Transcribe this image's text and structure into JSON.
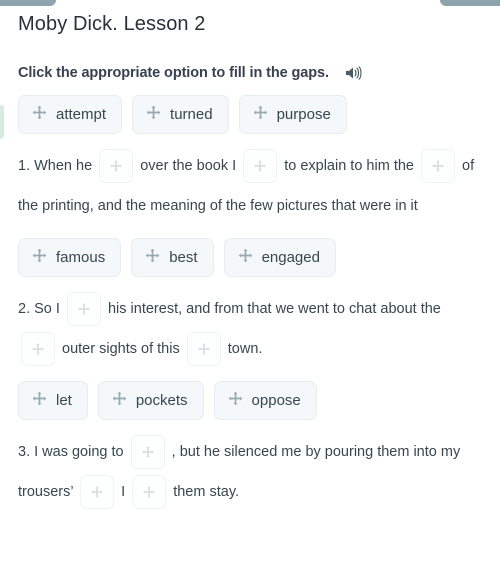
{
  "window": {
    "chrome_bar_color": "#8ea4ac",
    "left_accent_color": "#d9ecdf"
  },
  "header": {
    "lesson_title": "Moby Dick. Lesson 2"
  },
  "instruction": {
    "text": "Click the appropriate option to fill in the gaps.",
    "audio_icon": "speaker-icon"
  },
  "colors": {
    "chip_background": "#f4f8fa",
    "chip_border": "#e6edf1",
    "text": "#37474f",
    "icon": "#96a8b4",
    "gap_icon": "#d7dee3"
  },
  "exercise": {
    "blocks": [
      {
        "word_bank": [
          {
            "label": "attempt",
            "icon": "move-icon"
          },
          {
            "label": "turned",
            "icon": "move-icon"
          },
          {
            "label": "purpose",
            "icon": "move-icon"
          }
        ],
        "sentence_number": "1.",
        "segments": [
          {
            "type": "text",
            "value": "1. When he "
          },
          {
            "type": "gap"
          },
          {
            "type": "text",
            "value": " over the book I "
          },
          {
            "type": "gap"
          },
          {
            "type": "text",
            "value": " to explain to him the "
          },
          {
            "type": "gap"
          },
          {
            "type": "text",
            "value": " of the printing, and the meaning of the few pictures that were in it"
          }
        ]
      },
      {
        "word_bank": [
          {
            "label": "famous",
            "icon": "move-icon"
          },
          {
            "label": "best",
            "icon": "move-icon"
          },
          {
            "label": "engaged",
            "icon": "move-icon"
          }
        ],
        "sentence_number": "2.",
        "segments": [
          {
            "type": "text",
            "value": "2. So I "
          },
          {
            "type": "gap"
          },
          {
            "type": "text",
            "value": " his interest, and from that we went to chat about the "
          },
          {
            "type": "gap"
          },
          {
            "type": "text",
            "value": " outer sights of this "
          },
          {
            "type": "gap"
          },
          {
            "type": "text",
            "value": " town."
          }
        ]
      },
      {
        "word_bank": [
          {
            "label": "let",
            "icon": "move-icon"
          },
          {
            "label": "pockets",
            "icon": "move-icon"
          },
          {
            "label": "oppose",
            "icon": "move-icon"
          }
        ],
        "sentence_number": "3.",
        "segments": [
          {
            "type": "text",
            "value": "3. I was going to "
          },
          {
            "type": "gap"
          },
          {
            "type": "text",
            "value": " , but he silenced me by pouring them into my trousers’ "
          },
          {
            "type": "gap"
          },
          {
            "type": "text",
            "value": " I "
          },
          {
            "type": "gap"
          },
          {
            "type": "text",
            "value": " them stay."
          }
        ]
      }
    ]
  }
}
